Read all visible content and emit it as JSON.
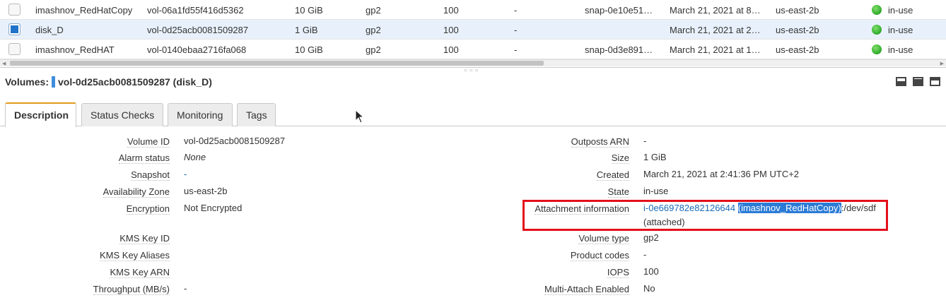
{
  "table": {
    "rows": [
      {
        "name": "imashnov_RedHatCopy",
        "volume_id": "vol-06a1fd55f416d5362",
        "size": "10 GiB",
        "type": "gp2",
        "iops": "100",
        "throughput": "-",
        "snapshot": "snap-0e10e51…",
        "created": "March 21, 2021 at 8…",
        "zone": "us-east-2b",
        "state": "in-use"
      },
      {
        "name": "disk_D",
        "volume_id": "vol-0d25acb0081509287",
        "size": "1 GiB",
        "type": "gp2",
        "iops": "100",
        "throughput": "-",
        "snapshot": "",
        "created": "March 21, 2021 at 2…",
        "zone": "us-east-2b",
        "state": "in-use"
      },
      {
        "name": "imashnov_RedHAT",
        "volume_id": "vol-0140ebaa2716fa068",
        "size": "10 GiB",
        "type": "gp2",
        "iops": "100",
        "throughput": "-",
        "snapshot": "snap-0d3e891…",
        "created": "March 21, 2021 at 1…",
        "zone": "us-east-2b",
        "state": "in-use"
      }
    ],
    "status_color": "#2ea82a"
  },
  "details": {
    "title_prefix": "Volumes:",
    "title_value": "vol-0d25acb0081509287 (disk_D)",
    "accent": "#3e8ddd"
  },
  "tabs": [
    "Description",
    "Status Checks",
    "Monitoring",
    "Tags"
  ],
  "left_props": [
    {
      "label": "Volume ID",
      "value": "vol-0d25acb0081509287"
    },
    {
      "label": "Alarm status",
      "value": "None"
    },
    {
      "label": "Snapshot",
      "value": "-"
    },
    {
      "label": "Availability Zone",
      "value": "us-east-2b"
    },
    {
      "label": "Encryption",
      "value": "Not Encrypted"
    },
    {
      "label": "KMS Key ID",
      "value": ""
    },
    {
      "label": "KMS Key Aliases",
      "value": ""
    },
    {
      "label": "KMS Key ARN",
      "value": ""
    },
    {
      "label": "Throughput (MB/s)",
      "value": "-"
    }
  ],
  "right_props": [
    {
      "label": "Outposts ARN",
      "value": "-"
    },
    {
      "label": "Size",
      "value": "1 GiB"
    },
    {
      "label": "Created",
      "value": "March 21, 2021 at 2:41:36 PM UTC+2"
    },
    {
      "label": "State",
      "value": "in-use"
    },
    {
      "label": "Attachment information",
      "instance": "i-0e669782e82126644",
      "instance_name": "(imashnov_RedHatCopy)",
      "device": ":/dev/sdf",
      "status": "(attached)"
    },
    {
      "label": "Volume type",
      "value": "gp2"
    },
    {
      "label": "Product codes",
      "value": "-"
    },
    {
      "label": "IOPS",
      "value": "100"
    },
    {
      "label": "Multi-Attach Enabled",
      "value": "No"
    }
  ],
  "highlight_color": "#e3101a"
}
